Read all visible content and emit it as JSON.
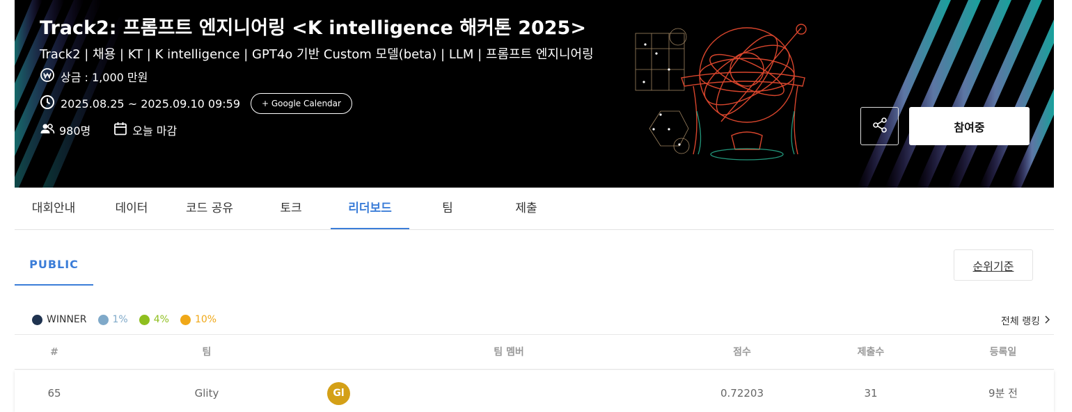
{
  "banner": {
    "title": "Track2: 프롬프트 엔지니어링 <K intelligence 해커톤 2025>",
    "tags": "Track2 | 채용 | KT | K intelligence | GPT4o 기반 Custom 모델(beta) | LLM | 프롬프트 엔지니어링",
    "prize": "상금 : 1,000 만원",
    "period": "2025.08.25 ~ 2025.09.10 09:59",
    "gcal_label": "+ Google Calendar",
    "participants": "980명",
    "deadline": "오늘 마감",
    "join_label": "참여중",
    "icons": {
      "prize": "won-coin-icon",
      "period": "clock-icon",
      "participants": "people-icon",
      "deadline": "calendar-icon",
      "share": "share-icon"
    }
  },
  "nav": {
    "items": [
      "대회안내",
      "데이터",
      "코드 공유",
      "토크",
      "리더보드",
      "팀",
      "제출"
    ],
    "active": "리더보드"
  },
  "leaderboard": {
    "subtab": "PUBLIC",
    "sort_label": "순위기준",
    "full_ranking_label": "전체 랭킹",
    "legend": [
      {
        "label": "WINNER",
        "color": "#1f3350",
        "text_color": "#333333"
      },
      {
        "label": "1%",
        "color": "#7fa9c9",
        "text_color": "#7fa9c9"
      },
      {
        "label": "4%",
        "color": "#8fbf1f",
        "text_color": "#8fbf1f"
      },
      {
        "label": "10%",
        "color": "#f0a818",
        "text_color": "#f0a818"
      }
    ],
    "columns": {
      "rank": "#",
      "team": "팀",
      "members": "팀 멤버",
      "score": "점수",
      "submissions": "제출수",
      "registered": "등록일"
    },
    "rows": [
      {
        "rank": "65",
        "team": "Glity",
        "avatar": "Gl",
        "avatar_color": "#d4a017",
        "score": "0.72203",
        "submissions": "31",
        "registered": "9분 전"
      }
    ]
  },
  "colors": {
    "accent": "#3b7dd8",
    "banner_bg": "#000000"
  }
}
